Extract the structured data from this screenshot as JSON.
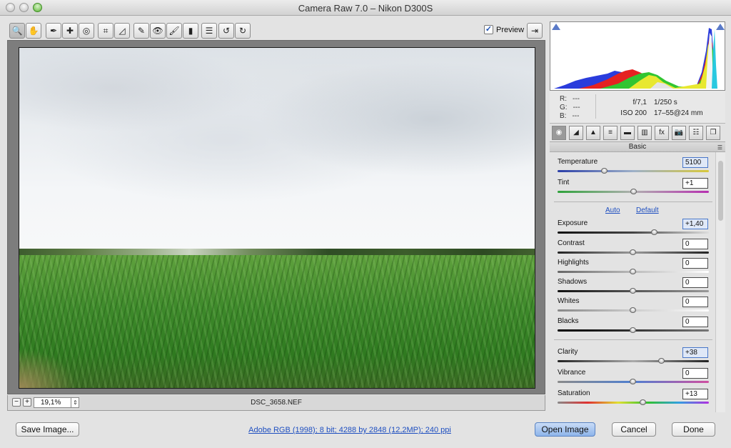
{
  "window": {
    "title": "Camera Raw 7.0  –  Nikon D300S"
  },
  "toolbar": {
    "tools": [
      {
        "name": "zoom-tool-icon",
        "glyph": "🔍"
      },
      {
        "name": "hand-tool-icon",
        "glyph": "✋"
      },
      {
        "name": "white-balance-tool-icon",
        "glyph": "✒"
      },
      {
        "name": "color-sampler-tool-icon",
        "glyph": "✚"
      },
      {
        "name": "targeted-adjustment-tool-icon",
        "glyph": "◎"
      },
      {
        "name": "crop-tool-icon",
        "glyph": "⌗"
      },
      {
        "name": "straighten-tool-icon",
        "glyph": "◿"
      },
      {
        "name": "spot-removal-tool-icon",
        "glyph": "✎"
      },
      {
        "name": "red-eye-tool-icon",
        "glyph": "👁"
      },
      {
        "name": "adjustment-brush-icon",
        "glyph": "🖌"
      },
      {
        "name": "graduated-filter-icon",
        "glyph": "▮"
      },
      {
        "name": "preferences-icon",
        "glyph": "☰"
      },
      {
        "name": "rotate-left-icon",
        "glyph": "↺"
      },
      {
        "name": "rotate-right-icon",
        "glyph": "↻"
      }
    ],
    "preview_label": "Preview",
    "preview_checked": "✓",
    "fullscreen_glyph": "⇥"
  },
  "status": {
    "zoom_out": "−",
    "zoom_in": "+",
    "zoom_value": "19,1%",
    "zoom_step": "⇕",
    "filename": "DSC_3658.NEF"
  },
  "info": {
    "r_label": "R:",
    "r_value": "---",
    "g_label": "G:",
    "g_value": "---",
    "b_label": "B:",
    "b_value": "---",
    "aperture": "f/7,1",
    "shutter": "1/250 s",
    "iso": "ISO 200",
    "lens": "17–55@24 mm"
  },
  "panel": {
    "tabs": [
      "◉",
      "◢",
      "▲",
      "≡",
      "▬",
      "▥",
      "fx",
      "📷",
      "☷",
      "❐"
    ],
    "title": "Basic",
    "menu_glyph": "☰",
    "auto_label": "Auto",
    "default_label": "Default",
    "controls": [
      {
        "name": "temperature",
        "label": "Temperature",
        "value": "5100",
        "pos": 0.31,
        "track": "linear-gradient(90deg,#2b3fa8,#9db0c8,#d8c83a)",
        "focus": true
      },
      {
        "name": "tint",
        "label": "Tint",
        "value": "+1",
        "pos": 0.505,
        "track": "linear-gradient(90deg,#2ea23a,#b0b0b0,#b62fb0)"
      },
      {
        "name": "exposure",
        "label": "Exposure",
        "value": "+1,40",
        "pos": 0.64,
        "track": "linear-gradient(90deg,#111,#444,#ddd)",
        "focus": true
      },
      {
        "name": "contrast",
        "label": "Contrast",
        "value": "0",
        "pos": 0.5,
        "track": "linear-gradient(90deg,#222,#9a9a9a,#222)"
      },
      {
        "name": "highlights",
        "label": "Highlights",
        "value": "0",
        "pos": 0.5,
        "track": "linear-gradient(90deg,#666,#bbb,#fff)"
      },
      {
        "name": "shadows",
        "label": "Shadows",
        "value": "0",
        "pos": 0.5,
        "track": "linear-gradient(90deg,#111,#555,#999)"
      },
      {
        "name": "whites",
        "label": "Whites",
        "value": "0",
        "pos": 0.5,
        "track": "linear-gradient(90deg,#888,#ccc,#fff)"
      },
      {
        "name": "blacks",
        "label": "Blacks",
        "value": "0",
        "pos": 0.5,
        "track": "linear-gradient(90deg,#000,#333,#777)"
      },
      {
        "name": "clarity",
        "label": "Clarity",
        "value": "+38",
        "pos": 0.69,
        "track": "linear-gradient(90deg,#222,#aaa,#222)",
        "focus": true
      },
      {
        "name": "vibrance",
        "label": "Vibrance",
        "value": "0",
        "pos": 0.5,
        "track": "linear-gradient(90deg,#8a8a8a,#4f7fd0,#d04fa0)"
      },
      {
        "name": "saturation",
        "label": "Saturation",
        "value": "+13",
        "pos": 0.565,
        "track": "linear-gradient(90deg,#888,#e03030,#e0e030,#30c030,#30a0e0,#b030e0)"
      }
    ]
  },
  "footer": {
    "save_label": "Save Image...",
    "workflow_label": "Adobe RGB (1998); 8 bit; 4288 by 2848 (12,2MP); 240 ppi",
    "open_label": "Open Image",
    "cancel_label": "Cancel",
    "done_label": "Done"
  }
}
